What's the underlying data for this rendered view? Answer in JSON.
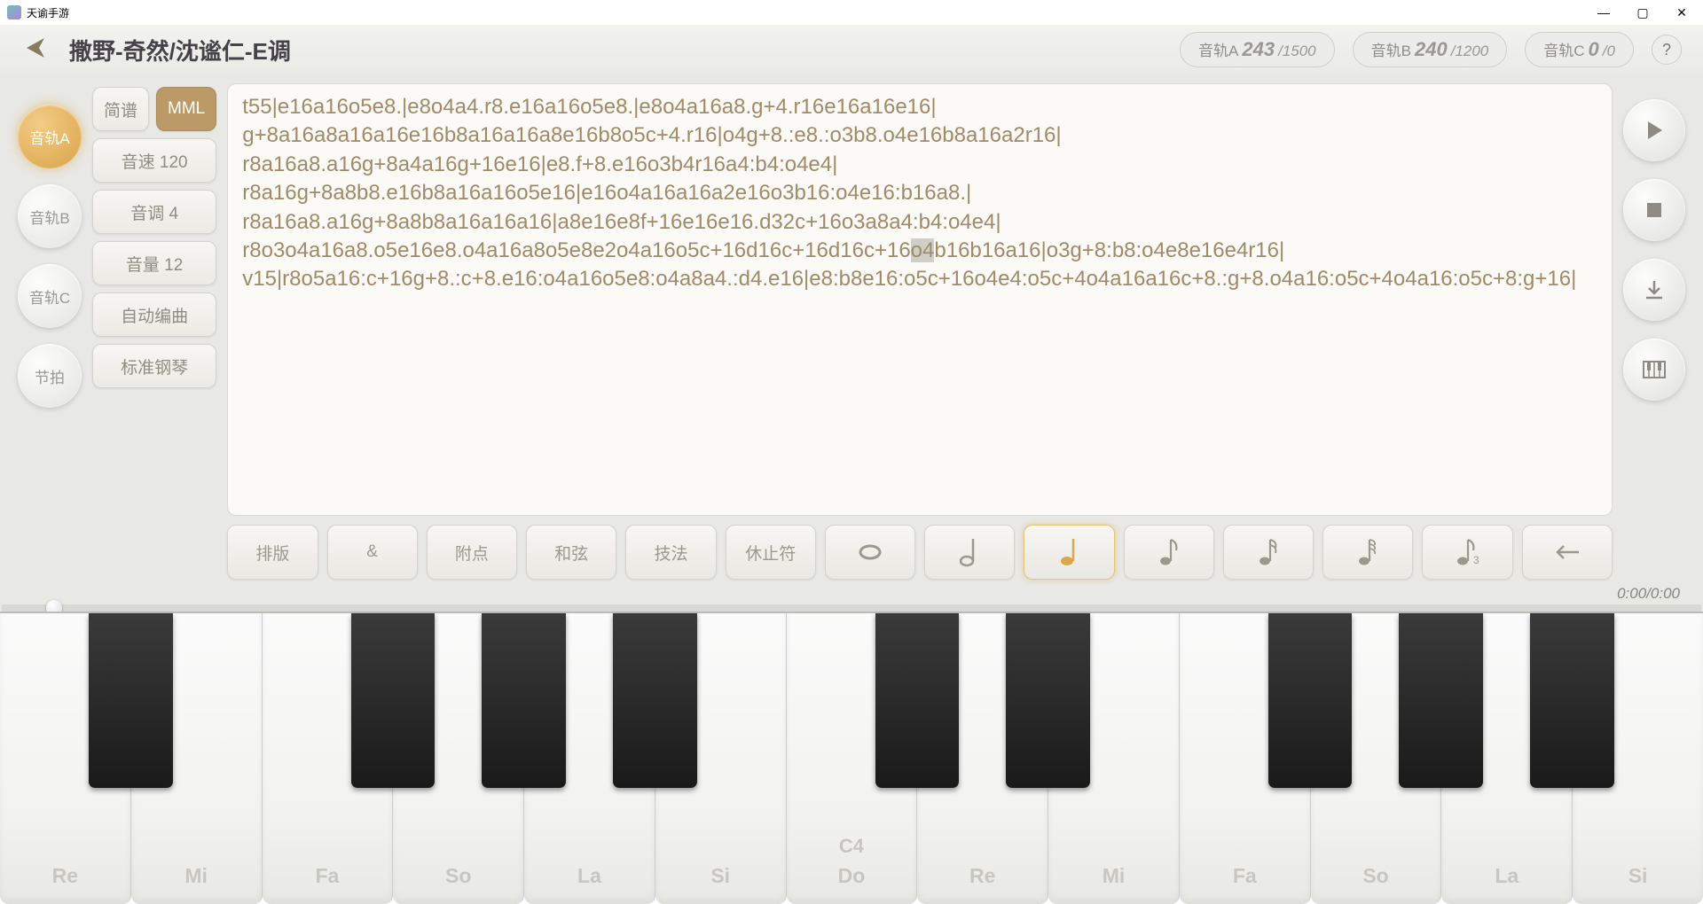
{
  "window": {
    "title": "天谕手游"
  },
  "header": {
    "title": "撒野-奇然/沈谧仁-E调",
    "tracks": [
      {
        "label": "音轨A",
        "value": "243",
        "max": "1500"
      },
      {
        "label": "音轨B",
        "value": "240",
        "max": "1200"
      },
      {
        "label": "音轨C",
        "value": "0",
        "max": "0"
      }
    ]
  },
  "left_tracks": [
    "音轨A",
    "音轨B",
    "音轨C",
    "节拍"
  ],
  "params": {
    "notation_a": "简谱",
    "notation_b": "MML",
    "speed": "音速 120",
    "tone": "音调 4",
    "volume": "音量 12",
    "auto": "自动编曲",
    "instrument": "标准钢琴"
  },
  "mml": {
    "pre": "t55|e16a16o5e8.|e8o4a4.r8.e16a16o5e8.|e8o4a16a8.g+4.r16e16a16e16|\ng+8a16a8a16a16e16b8a16a16a8e16b8o5c+4.r16|o4g+8.:e8.:o3b8.o4e16b8a16a2r16|\nr8a16a8.a16g+8a4a16g+16e16|e8.f+8.e16o3b4r16a4:b4:o4e4|\nr8a16g+8a8b8.e16b8a16a16o5e16|e16o4a16a16a2e16o3b16:o4e16:b16a8.|\nr8a16a8.a16g+8a8b8a16a16a16|a8e16e8f+16e16e16.d32c+16o3a8a4:b4:o4e4|\nr8o3o4a16a8.o5e16e8.o4a16a8o5e8e2o4a16o5c+16d16c+16d16c+16",
    "hl": "o4",
    "post": "b16b16a16|o3g+8:b8:o4e8e16e4r16|\nv15|r8o5a16:c+16g+8.:c+8.e16:o4a16o5e8:o4a8a4.:d4.e16|e8:b8e16:o5c+16o4e4:o5c+4o4a16a16c+8.:g+8.o4a16:o5c+4o4a16:o5c+8:g+16|"
  },
  "toolbar": {
    "items": [
      "排版",
      "&",
      "附点",
      "和弦",
      "技法",
      "休止符"
    ]
  },
  "time": "0:00/0:00",
  "keys": {
    "white": [
      "Re",
      "Mi",
      "Fa",
      "So",
      "La",
      "Si",
      "Do",
      "Re",
      "Mi",
      "Fa",
      "So",
      "La",
      "Si"
    ],
    "c4_upper": "C4",
    "c4_index": 6,
    "black_present": [
      true,
      false,
      true,
      true,
      true,
      false,
      true,
      true,
      false,
      true,
      true,
      true
    ]
  }
}
